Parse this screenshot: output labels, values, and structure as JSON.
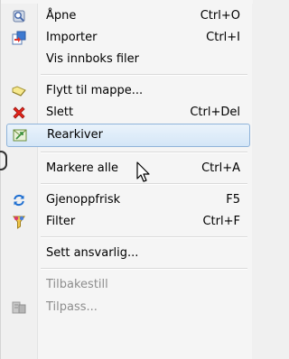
{
  "menu": {
    "items": [
      {
        "label": "Åpne",
        "shortcut": "Ctrl+O",
        "icon": "open-icon",
        "enabled": true
      },
      {
        "label": "Importer",
        "shortcut": "Ctrl+I",
        "icon": "import-icon",
        "enabled": true
      },
      {
        "label": "Vis innboks filer",
        "shortcut": "",
        "icon": "",
        "enabled": true
      },
      {
        "label": "Flytt til mappe...",
        "shortcut": "",
        "icon": "folder-icon",
        "enabled": true
      },
      {
        "label": "Slett",
        "shortcut": "Ctrl+Del",
        "icon": "delete-icon",
        "enabled": true
      },
      {
        "label": "Rearkiver",
        "shortcut": "",
        "icon": "rearchive-icon",
        "enabled": true,
        "highlighted": true
      },
      {
        "label": "Markere alle",
        "shortcut": "Ctrl+A",
        "icon": "",
        "enabled": true
      },
      {
        "label": "Gjenoppfrisk",
        "shortcut": "F5",
        "icon": "refresh-icon",
        "enabled": true
      },
      {
        "label": "Filter",
        "shortcut": "Ctrl+F",
        "icon": "filter-icon",
        "enabled": true
      },
      {
        "label": "Sett ansvarlig...",
        "shortcut": "",
        "icon": "",
        "enabled": true
      },
      {
        "label": "Tilbakestill",
        "shortcut": "",
        "icon": "",
        "enabled": false
      },
      {
        "label": "Tilpass...",
        "shortcut": "",
        "icon": "customize-icon",
        "enabled": false
      }
    ]
  },
  "colors": {
    "highlight_border": "#8fb3d9",
    "highlight_fill": "#d4e6f7",
    "disabled_text": "#8d8d8d"
  }
}
